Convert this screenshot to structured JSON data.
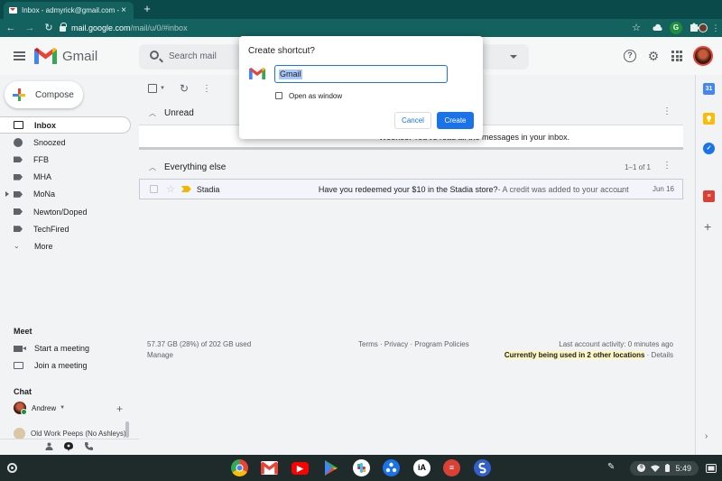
{
  "browser": {
    "tab_title": "Inbox - admyrick@gmail.com - G",
    "tab_close": "×",
    "new_tab": "+",
    "url_host": "mail.google.com",
    "url_path": "/mail/u/0/#inbox",
    "back": "←",
    "forward": "→",
    "reload": "↻",
    "star": "☆",
    "ext_grammarly": "G",
    "menu": "⋮"
  },
  "gmail": {
    "logo_text": "Gmail",
    "search_placeholder": "Search mail",
    "help": "?",
    "compose_label": "Compose"
  },
  "nav": {
    "items": [
      {
        "label": "Inbox"
      },
      {
        "label": "Snoozed"
      },
      {
        "label": "FFB"
      },
      {
        "label": "MHA"
      },
      {
        "label": "MoNa"
      },
      {
        "label": "Newton/Doped"
      },
      {
        "label": "TechFired"
      },
      {
        "label": "More"
      }
    ]
  },
  "meet": {
    "title": "Meet",
    "start": "Start a meeting",
    "join": "Join a meeting"
  },
  "chat": {
    "title": "Chat",
    "user": "Andrew",
    "add": "+",
    "group": "Old Work Peeps (No Ashleys)"
  },
  "list": {
    "unread": {
      "title": "Unread",
      "empty_message": "Woohoo! You've read all the messages in your inbox."
    },
    "everything": {
      "title": "Everything else",
      "count": "1–1 of 1"
    },
    "rows": [
      {
        "sender": "Stadia",
        "subject": "Have you redeemed your $10 in the Stadia store?",
        "snippet": " - A credit was added to your account",
        "ellipsis": "...",
        "date": "Jun 16"
      }
    ]
  },
  "footer": {
    "storage": "57.37 GB (28%) of 202 GB used",
    "manage": "Manage",
    "terms": "Terms · Privacy · Program Policies",
    "last_activity": "Last account activity: 0 minutes ago",
    "other_locations": "Currently being used in 2 other locations",
    "details": " · Details"
  },
  "dialog": {
    "title": "Create shortcut?",
    "input_value": "Gmail",
    "checkbox_label": "Open as window",
    "cancel": "Cancel",
    "create": "Create"
  },
  "sidepanel": {
    "calendar": "31",
    "plus": "+",
    "chevron": "›"
  },
  "shelf": {
    "time": "5:49",
    "ambient": "6",
    "apps": [
      "chrome-icon",
      "gmail-icon",
      "youtube-icon",
      "play-store-icon",
      "slack-icon",
      "docs-dots-icon",
      "ia-writer-icon",
      "todoist-icon",
      "simplenote-icon"
    ],
    "ia_label": "iA"
  },
  "colors": {
    "accent": "#1a73e8",
    "browser_frame": "#14625f",
    "gmail_red": "#ea4335",
    "highlight": "#fef7c0"
  }
}
